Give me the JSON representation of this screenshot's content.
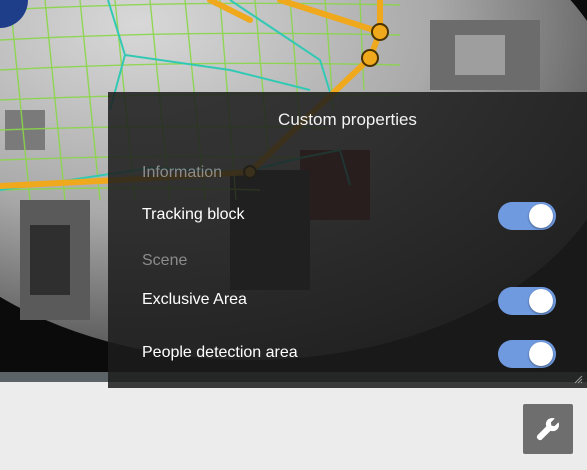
{
  "panel": {
    "title": "Custom properties",
    "sections": [
      {
        "label": "Information",
        "items": [
          {
            "label": "Tracking block",
            "enabled": true
          }
        ]
      },
      {
        "label": "Scene",
        "items": [
          {
            "label": "Exclusive Area",
            "enabled": true
          },
          {
            "label": "People detection area",
            "enabled": true
          }
        ]
      }
    ]
  },
  "colors": {
    "toggle_on": "#6f9ae0",
    "tracking_line": "#f0a81c",
    "area_outline": "#32c9b4",
    "grid": "#8ad64a"
  },
  "icons": {
    "settings_button": "wrench-icon"
  }
}
